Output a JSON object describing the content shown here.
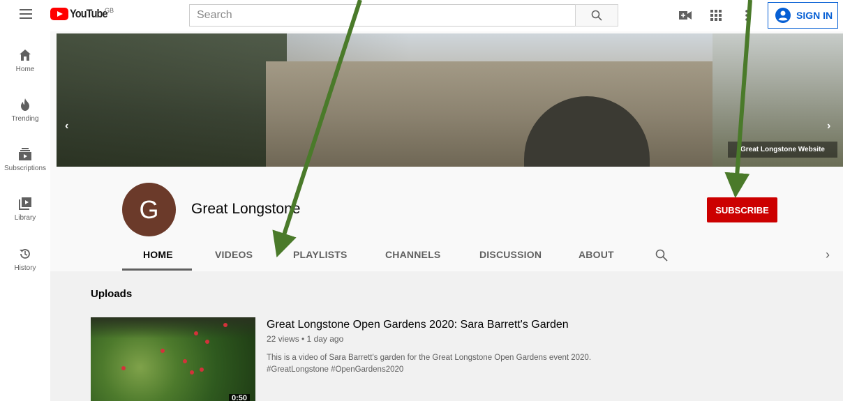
{
  "topbar": {
    "logo_text": "YouTube",
    "country": "GB",
    "search_placeholder": "Search",
    "signin_label": "SIGN IN"
  },
  "guide": {
    "items": [
      {
        "label": "Home",
        "icon": "home-icon"
      },
      {
        "label": "Trending",
        "icon": "flame-icon"
      },
      {
        "label": "Subscriptions",
        "icon": "subscriptions-icon"
      },
      {
        "label": "Library",
        "icon": "library-icon"
      },
      {
        "label": "History",
        "icon": "history-icon"
      }
    ]
  },
  "banner": {
    "link_label": "Great Longstone Website"
  },
  "channel": {
    "avatar_letter": "G",
    "name": "Great Longstone",
    "subscribe_label": "SUBSCRIBE",
    "avatar_color": "#6b3a2a",
    "subscribe_color": "#cc0000"
  },
  "tabs": [
    {
      "label": "HOME",
      "active": true
    },
    {
      "label": "VIDEOS",
      "active": false
    },
    {
      "label": "PLAYLISTS",
      "active": false
    },
    {
      "label": "CHANNELS",
      "active": false
    },
    {
      "label": "DISCUSSION",
      "active": false
    },
    {
      "label": "ABOUT",
      "active": false
    }
  ],
  "uploads": {
    "section_title": "Uploads",
    "video": {
      "title": "Great Longstone Open Gardens 2020: Sara Barrett's Garden",
      "meta": "22 views • 1 day ago",
      "desc_line1": "This is a video of Sara Barrett's garden for the Great Longstone Open Gardens event 2020.",
      "desc_line2": "#GreatLongstone #OpenGardens2020",
      "duration": "0:50"
    }
  },
  "annotation_color": "#4a7a2a"
}
